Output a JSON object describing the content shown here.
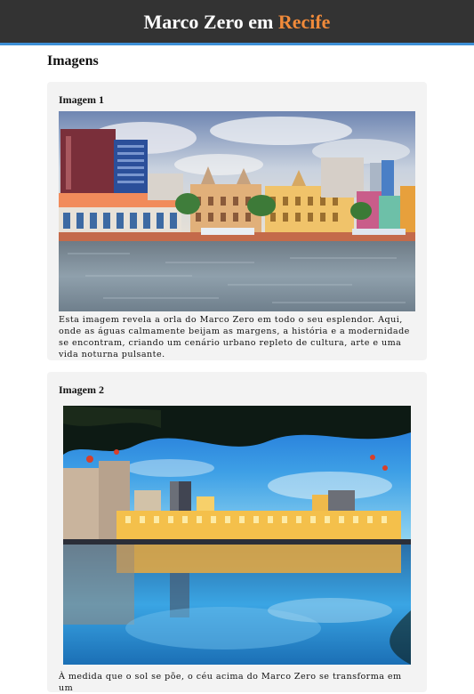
{
  "header": {
    "title_main": "Marco Zero em",
    "title_accent": "Recife",
    "colors": {
      "background": "#333333",
      "accent": "#f08a3a",
      "underline": "#3d8fd6"
    }
  },
  "section": {
    "title": "Imagens"
  },
  "cards": [
    {
      "title": "Imagem 1",
      "image_icon": "waterfront-photo",
      "text": "Esta imagem revela a orla do Marco Zero em todo o seu esplendor. Aqui, onde as águas calmamente beijam as margens, a história e a modernidade se encontram, criando um cenário urbano repleto de cultura, arte e uma vida noturna pulsante."
    },
    {
      "title": "Imagem 2",
      "image_icon": "sunset-reflection-photo",
      "text": "À medida que o sol se põe, o céu acima do Marco Zero se transforma em um"
    }
  ]
}
